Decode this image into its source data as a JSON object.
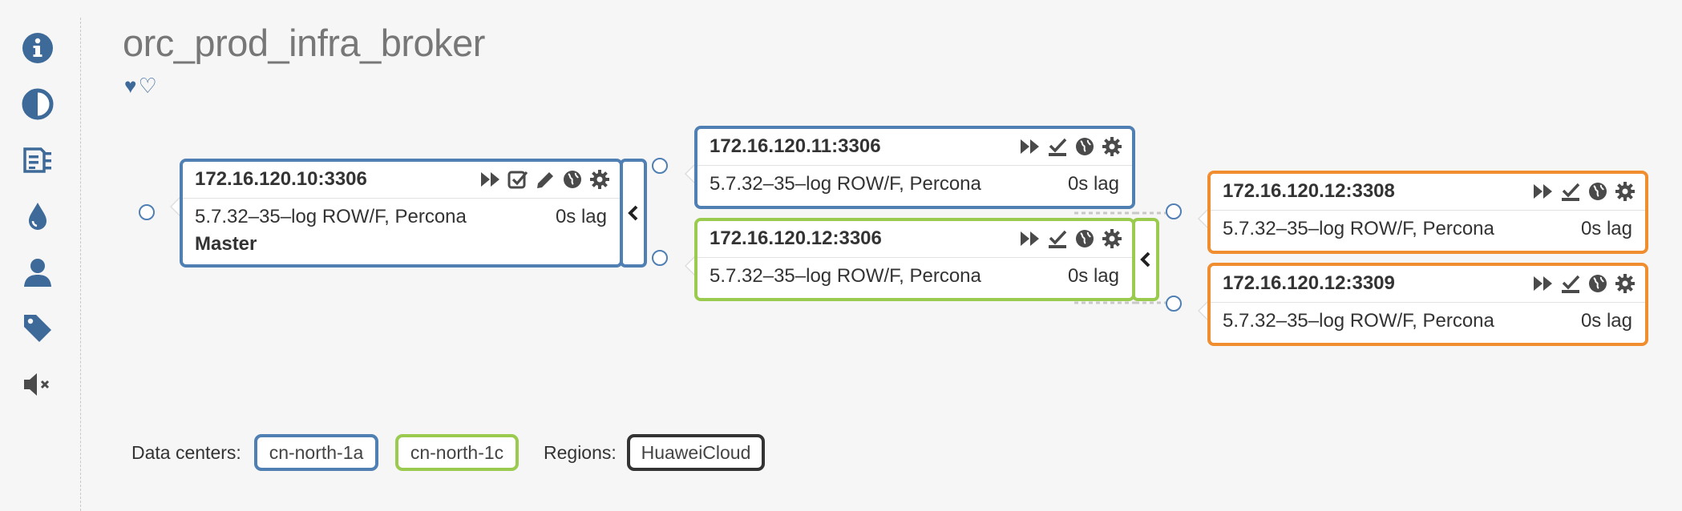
{
  "sidebar": {
    "items": [
      {
        "icon": "info-icon"
      },
      {
        "icon": "contrast-icon"
      },
      {
        "icon": "columns-icon"
      },
      {
        "icon": "drop-icon"
      },
      {
        "icon": "user-icon"
      },
      {
        "icon": "tag-icon"
      },
      {
        "icon": "volume-mute-icon"
      }
    ]
  },
  "cluster": {
    "title": "orc_prod_infra_broker",
    "hearts": [
      "♥",
      "♡"
    ]
  },
  "nodes": {
    "master": {
      "host": "172.16.120.10:3306",
      "version": "5.7.32–35–log ROW/F, Percona",
      "lag": "0s lag",
      "role": "Master",
      "datacenter": "cn-north-1a"
    },
    "replica_11": {
      "host": "172.16.120.11:3306",
      "version": "5.7.32–35–log ROW/F, Percona",
      "lag": "0s lag",
      "datacenter": "cn-north-1a"
    },
    "replica_12": {
      "host": "172.16.120.12:3306",
      "version": "5.7.32–35–log ROW/F, Percona",
      "lag": "0s lag",
      "datacenter": "cn-north-1c"
    },
    "replica_12_3308": {
      "host": "172.16.120.12:3308",
      "version": "5.7.32–35–log ROW/F, Percona",
      "lag": "0s lag"
    },
    "replica_12_3309": {
      "host": "172.16.120.12:3309",
      "version": "5.7.32–35–log ROW/F, Percona",
      "lag": "0s lag"
    }
  },
  "legend": {
    "datacenters_label": "Data centers:",
    "datacenters": [
      "cn-north-1a",
      "cn-north-1c"
    ],
    "regions_label": "Regions:",
    "regions": [
      "HuaweiCloud"
    ]
  },
  "colors": {
    "cn_north_1a": "#4f7fb3",
    "cn_north_1c": "#9bcb4e",
    "other": "#f08d2f",
    "region": "#333333",
    "icon": "#4a4a4a",
    "sidebar_icon": "#3d6a99"
  }
}
